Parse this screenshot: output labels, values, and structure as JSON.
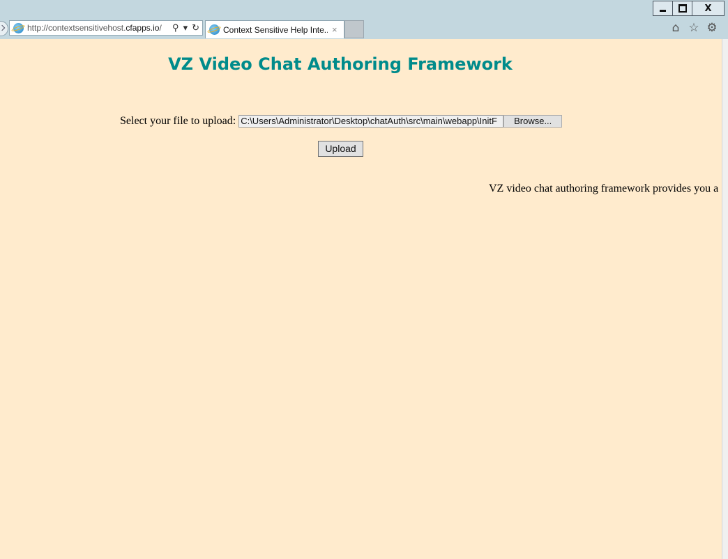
{
  "browser": {
    "address": {
      "prefix": "http://contextsensitivehost.",
      "domain": "cfapps.io",
      "suffix": "/"
    },
    "tab": {
      "title": "Context Sensitive Help Inte...",
      "close": "×"
    },
    "window_controls": {
      "close": "X"
    }
  },
  "page": {
    "title": "VZ Video Chat Authoring Framework",
    "upload": {
      "label": "Select your file to upload:",
      "file_value": "C:\\Users\\Administrator\\Desktop\\chatAuth\\src\\main\\webapp\\InitF",
      "browse_label": "Browse...",
      "upload_label": "Upload"
    },
    "marquee_text": "VZ video chat authoring framework provides you a"
  },
  "colors": {
    "page_background": "#ffebcd",
    "title": "#008b8b"
  }
}
